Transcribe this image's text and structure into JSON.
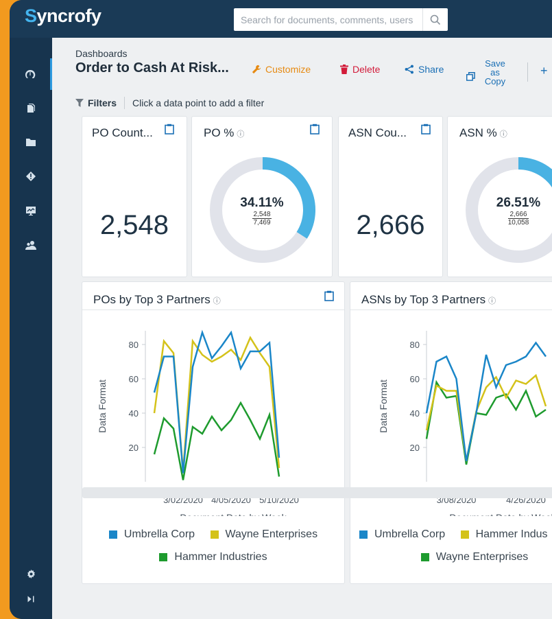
{
  "app": {
    "logo_text": "yncrofy",
    "logo_initial": "S",
    "search_placeholder": "Search for documents, comments, users"
  },
  "sidebar": {
    "items": [
      {
        "icon": "dashboard-icon"
      },
      {
        "icon": "documents-icon"
      },
      {
        "icon": "folder-icon"
      },
      {
        "icon": "alert-icon"
      },
      {
        "icon": "monitor-icon"
      },
      {
        "icon": "users-icon"
      }
    ],
    "bottom": [
      {
        "icon": "gear-icon"
      },
      {
        "icon": "collapse-icon"
      }
    ]
  },
  "header": {
    "breadcrumb": "Dashboards",
    "title": "Order to Cash At Risk...",
    "customize_label": "Customize",
    "delete_label": "Delete",
    "share_label": "Share",
    "save_label_1": "Save",
    "save_label_2": "as",
    "save_label_3": "Copy",
    "add_label": "+"
  },
  "filters": {
    "label": "Filters",
    "hint": "Click a data point to add a filter"
  },
  "kpis": {
    "po_count": {
      "title": "PO Count...",
      "value": "2,548"
    },
    "po_pct": {
      "title": "PO %",
      "info": "ⓘ",
      "value": "34.11%",
      "numerator": "2,548",
      "denominator": "7,469",
      "fraction": 0.3411
    },
    "asn_count": {
      "title": "ASN Cou...",
      "value": "2,666"
    },
    "asn_pct": {
      "title": "ASN %",
      "info": "ⓘ",
      "value": "26.51%",
      "numerator": "2,666",
      "denominator": "10,058",
      "fraction": 0.2651
    }
  },
  "colors": {
    "blue": "#1a86c8",
    "yellow": "#d4c21a",
    "green": "#1e9b2e",
    "donut_track": "#e1e3ea",
    "donut_fill": "#49b2e3"
  },
  "charts": {
    "po": {
      "title": "POs by Top 3 Partners",
      "info": "ⓘ",
      "legend": [
        "Umbrella Corp",
        "Wayne Enterprises",
        "Hammer Industries"
      ]
    },
    "asn": {
      "title": "ASNs by Top 3 Partners",
      "info": "ⓘ",
      "legend": [
        "Umbrella Corp",
        "Hammer Indus",
        "Wayne Enterprises"
      ]
    }
  },
  "chart_data": [
    {
      "type": "line",
      "title": "POs by Top 3 Partners",
      "xlabel": "Document Date by Week",
      "ylabel": "Data Format",
      "yticks": [
        20,
        40,
        60,
        80
      ],
      "ylim": [
        0,
        88
      ],
      "xtick_labels": [
        {
          "label": "3/02/2020",
          "index": 3
        },
        {
          "label": "4/05/2020",
          "index": 8
        },
        {
          "label": "5/10/2020",
          "index": 13
        }
      ],
      "points": 16,
      "series": [
        {
          "name": "Umbrella Corp",
          "color": "#1a86c8",
          "values": [
            52,
            73,
            73,
            5,
            67,
            87,
            72,
            79,
            87,
            66,
            76,
            76,
            81,
            14,
            null,
            null
          ]
        },
        {
          "name": "Wayne Enterprises",
          "color": "#d4c21a",
          "values": [
            40,
            82,
            75,
            6,
            82,
            74,
            70,
            73,
            77,
            71,
            84,
            75,
            67,
            8,
            null,
            null
          ]
        },
        {
          "name": "Hammer Industries",
          "color": "#1e9b2e",
          "values": [
            16,
            37,
            31,
            1,
            32,
            28,
            38,
            30,
            36,
            46,
            36,
            25,
            39,
            3,
            null,
            null
          ]
        }
      ]
    },
    {
      "type": "line",
      "title": "ASNs by Top 3 Partners",
      "xlabel": "Document Date by Week",
      "ylabel": "Data Format",
      "yticks": [
        20,
        40,
        60,
        80
      ],
      "ylim": [
        0,
        88
      ],
      "xtick_labels": [
        {
          "label": "3/08/2020",
          "index": 3
        },
        {
          "label": "4/26/2020",
          "index": 10
        }
      ],
      "points": 13,
      "series": [
        {
          "name": "Umbrella Corp",
          "color": "#1a86c8",
          "values": [
            40,
            70,
            73,
            60,
            12,
            40,
            74,
            55,
            68,
            70,
            73,
            81,
            73
          ]
        },
        {
          "name": "Hammer Indus",
          "color": "#d4c21a",
          "values": [
            30,
            56,
            53,
            53,
            12,
            41,
            55,
            61,
            49,
            59,
            57,
            62,
            44
          ]
        },
        {
          "name": "Wayne Enterprises",
          "color": "#1e9b2e",
          "values": [
            25,
            58,
            49,
            50,
            10,
            40,
            39,
            49,
            51,
            42,
            53,
            38,
            42
          ]
        }
      ]
    }
  ]
}
